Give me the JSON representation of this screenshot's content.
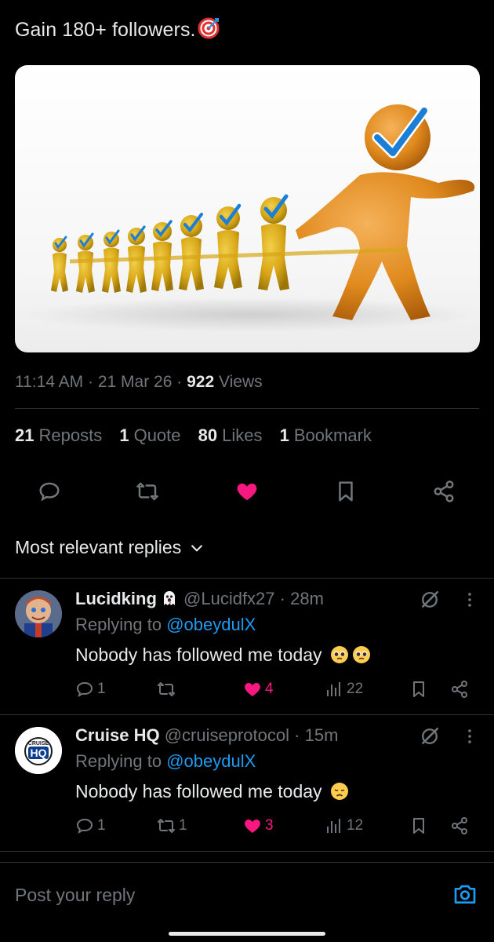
{
  "tweet": {
    "text": "Gain  180+ followers.",
    "target_icon": "direct-hit-target-icon",
    "time": "11:14 AM",
    "date": "21 Mar 26",
    "views_count": "922",
    "views_label": "Views",
    "sep": "·"
  },
  "stats": {
    "reposts_count": "21",
    "reposts_label": "Reposts",
    "quotes_count": "1",
    "quotes_label": "Quote",
    "likes_count": "80",
    "likes_label": "Likes",
    "bookmarks_count": "1",
    "bookmarks_label": "Bookmark"
  },
  "actions": {
    "icons": [
      "reply-icon",
      "repost-icon",
      "like-icon",
      "bookmark-icon",
      "share-icon"
    ],
    "liked": true,
    "like_color": "#f91880"
  },
  "sort": {
    "label": "Most relevant replies"
  },
  "replies": [
    {
      "name": "Lucidking",
      "name_emoji": "ghost-emoji",
      "handle": "@Lucidfx27",
      "time": "28m",
      "replying_prefix": "Replying to ",
      "replying_to": "@obeydulX",
      "text": "Nobody has followed me today",
      "text_emoji": "pleading-face-emoji x2",
      "replies": "1",
      "reposts": "",
      "likes": "4",
      "views": "22",
      "liked": true
    },
    {
      "name": "Cruise HQ",
      "handle": "@cruiseprotocol",
      "time": "15m",
      "replying_prefix": "Replying to ",
      "replying_to": "@obeydulX",
      "text": "Nobody has followed me today",
      "text_emoji": "disappointed-face-emoji",
      "avatar_text_top": "CRUISE",
      "avatar_text_main": "HQ",
      "replies": "1",
      "reposts": "1",
      "likes": "3",
      "views": "12",
      "liked": true
    }
  ],
  "composer": {
    "placeholder": "Post your reply"
  },
  "colors": {
    "accent": "#1d9bf0",
    "like": "#f91880",
    "muted": "#71767b",
    "text": "#e7e9ea",
    "background": "#000000"
  }
}
